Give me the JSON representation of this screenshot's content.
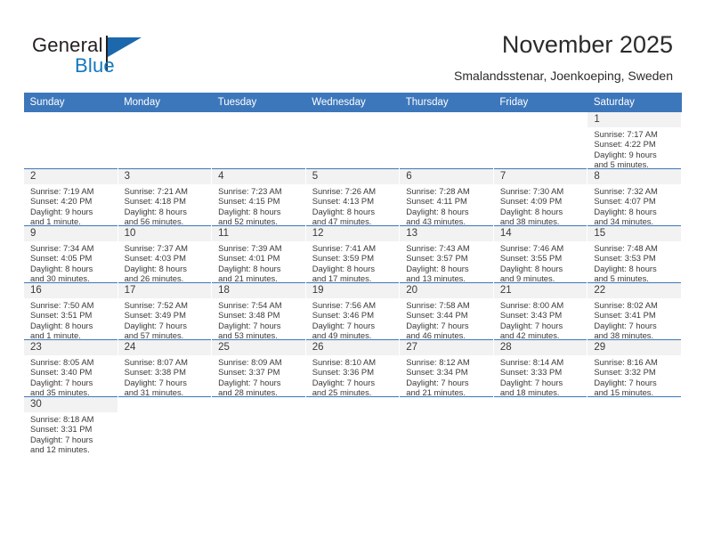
{
  "logo": {
    "name_top": "General",
    "name_bottom": "Blue",
    "brand_dark": "#231f20",
    "brand_blue": "#1278be"
  },
  "header": {
    "title": "November 2025",
    "subtitle": "Smalandsstenar, Joenkoeping, Sweden"
  },
  "theme": {
    "header_bg": "#3d77bb",
    "daynum_bg": "#f2f2f2",
    "row_divider": "#3d77bb"
  },
  "calendar": {
    "weekday_headers": [
      "Sunday",
      "Monday",
      "Tuesday",
      "Wednesday",
      "Thursday",
      "Friday",
      "Saturday"
    ],
    "weeks": [
      [
        {
          "empty": true
        },
        {
          "empty": true
        },
        {
          "empty": true
        },
        {
          "empty": true
        },
        {
          "empty": true
        },
        {
          "empty": true
        },
        {
          "day": "1",
          "sunrise": "Sunrise: 7:17 AM",
          "sunset": "Sunset: 4:22 PM",
          "daylight1": "Daylight: 9 hours",
          "daylight2": "and 5 minutes."
        }
      ],
      [
        {
          "day": "2",
          "sunrise": "Sunrise: 7:19 AM",
          "sunset": "Sunset: 4:20 PM",
          "daylight1": "Daylight: 9 hours",
          "daylight2": "and 1 minute."
        },
        {
          "day": "3",
          "sunrise": "Sunrise: 7:21 AM",
          "sunset": "Sunset: 4:18 PM",
          "daylight1": "Daylight: 8 hours",
          "daylight2": "and 56 minutes."
        },
        {
          "day": "4",
          "sunrise": "Sunrise: 7:23 AM",
          "sunset": "Sunset: 4:15 PM",
          "daylight1": "Daylight: 8 hours",
          "daylight2": "and 52 minutes."
        },
        {
          "day": "5",
          "sunrise": "Sunrise: 7:26 AM",
          "sunset": "Sunset: 4:13 PM",
          "daylight1": "Daylight: 8 hours",
          "daylight2": "and 47 minutes."
        },
        {
          "day": "6",
          "sunrise": "Sunrise: 7:28 AM",
          "sunset": "Sunset: 4:11 PM",
          "daylight1": "Daylight: 8 hours",
          "daylight2": "and 43 minutes."
        },
        {
          "day": "7",
          "sunrise": "Sunrise: 7:30 AM",
          "sunset": "Sunset: 4:09 PM",
          "daylight1": "Daylight: 8 hours",
          "daylight2": "and 38 minutes."
        },
        {
          "day": "8",
          "sunrise": "Sunrise: 7:32 AM",
          "sunset": "Sunset: 4:07 PM",
          "daylight1": "Daylight: 8 hours",
          "daylight2": "and 34 minutes."
        }
      ],
      [
        {
          "day": "9",
          "sunrise": "Sunrise: 7:34 AM",
          "sunset": "Sunset: 4:05 PM",
          "daylight1": "Daylight: 8 hours",
          "daylight2": "and 30 minutes."
        },
        {
          "day": "10",
          "sunrise": "Sunrise: 7:37 AM",
          "sunset": "Sunset: 4:03 PM",
          "daylight1": "Daylight: 8 hours",
          "daylight2": "and 26 minutes."
        },
        {
          "day": "11",
          "sunrise": "Sunrise: 7:39 AM",
          "sunset": "Sunset: 4:01 PM",
          "daylight1": "Daylight: 8 hours",
          "daylight2": "and 21 minutes."
        },
        {
          "day": "12",
          "sunrise": "Sunrise: 7:41 AM",
          "sunset": "Sunset: 3:59 PM",
          "daylight1": "Daylight: 8 hours",
          "daylight2": "and 17 minutes."
        },
        {
          "day": "13",
          "sunrise": "Sunrise: 7:43 AM",
          "sunset": "Sunset: 3:57 PM",
          "daylight1": "Daylight: 8 hours",
          "daylight2": "and 13 minutes."
        },
        {
          "day": "14",
          "sunrise": "Sunrise: 7:46 AM",
          "sunset": "Sunset: 3:55 PM",
          "daylight1": "Daylight: 8 hours",
          "daylight2": "and 9 minutes."
        },
        {
          "day": "15",
          "sunrise": "Sunrise: 7:48 AM",
          "sunset": "Sunset: 3:53 PM",
          "daylight1": "Daylight: 8 hours",
          "daylight2": "and 5 minutes."
        }
      ],
      [
        {
          "day": "16",
          "sunrise": "Sunrise: 7:50 AM",
          "sunset": "Sunset: 3:51 PM",
          "daylight1": "Daylight: 8 hours",
          "daylight2": "and 1 minute."
        },
        {
          "day": "17",
          "sunrise": "Sunrise: 7:52 AM",
          "sunset": "Sunset: 3:49 PM",
          "daylight1": "Daylight: 7 hours",
          "daylight2": "and 57 minutes."
        },
        {
          "day": "18",
          "sunrise": "Sunrise: 7:54 AM",
          "sunset": "Sunset: 3:48 PM",
          "daylight1": "Daylight: 7 hours",
          "daylight2": "and 53 minutes."
        },
        {
          "day": "19",
          "sunrise": "Sunrise: 7:56 AM",
          "sunset": "Sunset: 3:46 PM",
          "daylight1": "Daylight: 7 hours",
          "daylight2": "and 49 minutes."
        },
        {
          "day": "20",
          "sunrise": "Sunrise: 7:58 AM",
          "sunset": "Sunset: 3:44 PM",
          "daylight1": "Daylight: 7 hours",
          "daylight2": "and 46 minutes."
        },
        {
          "day": "21",
          "sunrise": "Sunrise: 8:00 AM",
          "sunset": "Sunset: 3:43 PM",
          "daylight1": "Daylight: 7 hours",
          "daylight2": "and 42 minutes."
        },
        {
          "day": "22",
          "sunrise": "Sunrise: 8:02 AM",
          "sunset": "Sunset: 3:41 PM",
          "daylight1": "Daylight: 7 hours",
          "daylight2": "and 38 minutes."
        }
      ],
      [
        {
          "day": "23",
          "sunrise": "Sunrise: 8:05 AM",
          "sunset": "Sunset: 3:40 PM",
          "daylight1": "Daylight: 7 hours",
          "daylight2": "and 35 minutes."
        },
        {
          "day": "24",
          "sunrise": "Sunrise: 8:07 AM",
          "sunset": "Sunset: 3:38 PM",
          "daylight1": "Daylight: 7 hours",
          "daylight2": "and 31 minutes."
        },
        {
          "day": "25",
          "sunrise": "Sunrise: 8:09 AM",
          "sunset": "Sunset: 3:37 PM",
          "daylight1": "Daylight: 7 hours",
          "daylight2": "and 28 minutes."
        },
        {
          "day": "26",
          "sunrise": "Sunrise: 8:10 AM",
          "sunset": "Sunset: 3:36 PM",
          "daylight1": "Daylight: 7 hours",
          "daylight2": "and 25 minutes."
        },
        {
          "day": "27",
          "sunrise": "Sunrise: 8:12 AM",
          "sunset": "Sunset: 3:34 PM",
          "daylight1": "Daylight: 7 hours",
          "daylight2": "and 21 minutes."
        },
        {
          "day": "28",
          "sunrise": "Sunrise: 8:14 AM",
          "sunset": "Sunset: 3:33 PM",
          "daylight1": "Daylight: 7 hours",
          "daylight2": "and 18 minutes."
        },
        {
          "day": "29",
          "sunrise": "Sunrise: 8:16 AM",
          "sunset": "Sunset: 3:32 PM",
          "daylight1": "Daylight: 7 hours",
          "daylight2": "and 15 minutes."
        }
      ],
      [
        {
          "day": "30",
          "sunrise": "Sunrise: 8:18 AM",
          "sunset": "Sunset: 3:31 PM",
          "daylight1": "Daylight: 7 hours",
          "daylight2": "and 12 minutes."
        },
        {
          "empty": true
        },
        {
          "empty": true
        },
        {
          "empty": true
        },
        {
          "empty": true
        },
        {
          "empty": true
        },
        {
          "empty": true
        }
      ]
    ]
  }
}
